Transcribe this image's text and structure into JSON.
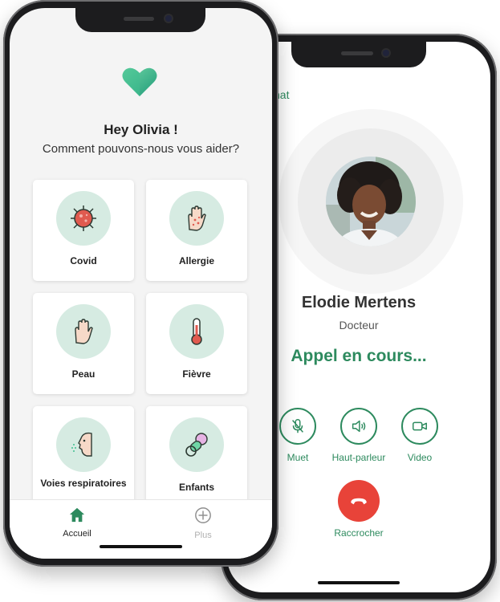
{
  "colors": {
    "brand_green": "#2d8a5e",
    "icon_bg": "#d6ebe2",
    "hangup_red": "#e84339"
  },
  "call_screen": {
    "back_tab_label": "hat",
    "doctor_name": "Elodie Mertens",
    "doctor_role": "Docteur",
    "call_status": "Appel en cours...",
    "controls": [
      {
        "label": "Muet",
        "icon": "mic-off-icon"
      },
      {
        "label": "Haut-parleur",
        "icon": "speaker-icon"
      },
      {
        "label": "Video",
        "icon": "video-camera-icon"
      }
    ],
    "hangup_label": "Raccrocher"
  },
  "home_screen": {
    "greeting": "Hey Olivia !",
    "subtitle": "Comment pouvons-nous vous aider?",
    "categories": [
      {
        "label": "Covid",
        "icon": "virus-icon"
      },
      {
        "label": "Allergie",
        "icon": "allergy-hand-icon"
      },
      {
        "label": "Peau",
        "icon": "hand-icon"
      },
      {
        "label": "Fièvre",
        "icon": "thermometer-icon"
      },
      {
        "label": "Voies respiratoires",
        "icon": "sneeze-face-icon"
      },
      {
        "label": "Enfants",
        "icon": "pacifier-icon"
      }
    ],
    "tabs": [
      {
        "label": "Accueil",
        "icon": "home-icon",
        "active": true
      },
      {
        "label": "Plus",
        "icon": "plus-circle-icon",
        "active": false
      }
    ]
  }
}
